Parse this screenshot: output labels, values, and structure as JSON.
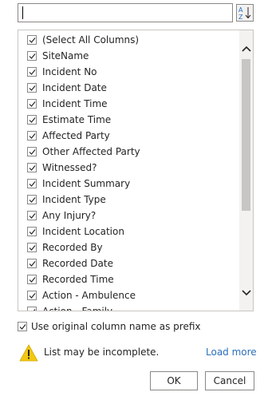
{
  "search": {
    "value": "",
    "placeholder": ""
  },
  "sort": {
    "icon": "sort-ascending-icon",
    "label_top": "A",
    "label_bottom": "Z"
  },
  "columns": [
    {
      "label": "(Select All Columns)",
      "checked": true
    },
    {
      "label": "SiteName",
      "checked": true
    },
    {
      "label": "Incident No",
      "checked": true
    },
    {
      "label": "Incident Date",
      "checked": true
    },
    {
      "label": "Incident Time",
      "checked": true
    },
    {
      "label": "Estimate Time",
      "checked": true
    },
    {
      "label": "Affected Party",
      "checked": true
    },
    {
      "label": "Other Affected Party",
      "checked": true
    },
    {
      "label": "Witnessed?",
      "checked": true
    },
    {
      "label": "Incident Summary",
      "checked": true
    },
    {
      "label": "Incident Type",
      "checked": true
    },
    {
      "label": "Any Injury?",
      "checked": true
    },
    {
      "label": "Incident Location",
      "checked": true
    },
    {
      "label": "Recorded By",
      "checked": true
    },
    {
      "label": "Recorded Date",
      "checked": true
    },
    {
      "label": "Recorded Time",
      "checked": true
    },
    {
      "label": "Action - Ambulence",
      "checked": true
    },
    {
      "label": "Action - Family",
      "checked": true
    }
  ],
  "prefix": {
    "label": "Use original column name as prefix",
    "checked": true
  },
  "warning": {
    "text": "List may be incomplete.",
    "icon": "warning-icon"
  },
  "load_more_label": "Load more",
  "ok_label": "OK",
  "cancel_label": "Cancel",
  "colors": {
    "link": "#2b6fbb",
    "warning": "#f2c811",
    "border": "#8a8886"
  }
}
